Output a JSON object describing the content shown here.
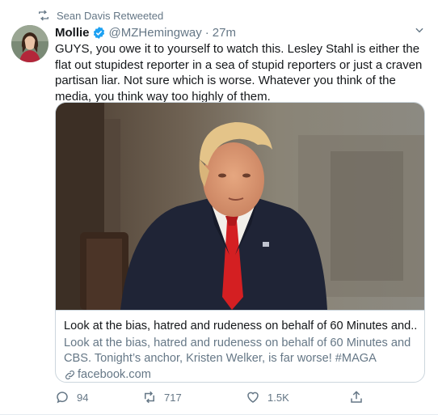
{
  "retweet_banner": {
    "text": "Sean Davis Retweeted",
    "icon": "retweet-icon"
  },
  "author": {
    "display_name": "Mollie",
    "handle": "@MZHemingway",
    "separator": "·",
    "timestamp": "27m",
    "verified": true
  },
  "tweet": {
    "text": "GUYS, you owe it to yourself to watch this. Lesley Stahl is either the flat out stupidest reporter in a sea of stupid reporters or just a craven partisan liar. Not sure which is worse. Whatever you think of the media, you think way too highly of them."
  },
  "link_card": {
    "title": "Look at the bias, hatred and rudeness on behalf of 60 Minutes and...",
    "description": "Look at the bias, hatred and rudeness on behalf of 60 Minutes and CBS. Tonight’s anchor, Kristen Welker, is far worse! #MAGA",
    "domain": "facebook.com"
  },
  "actions": {
    "reply_count": "94",
    "retweet_count": "717",
    "like_count": "1.5K"
  },
  "colors": {
    "text_primary": "#14171a",
    "text_secondary": "#657786",
    "verified_blue": "#1da1f2",
    "border": "#ccd6dd"
  }
}
